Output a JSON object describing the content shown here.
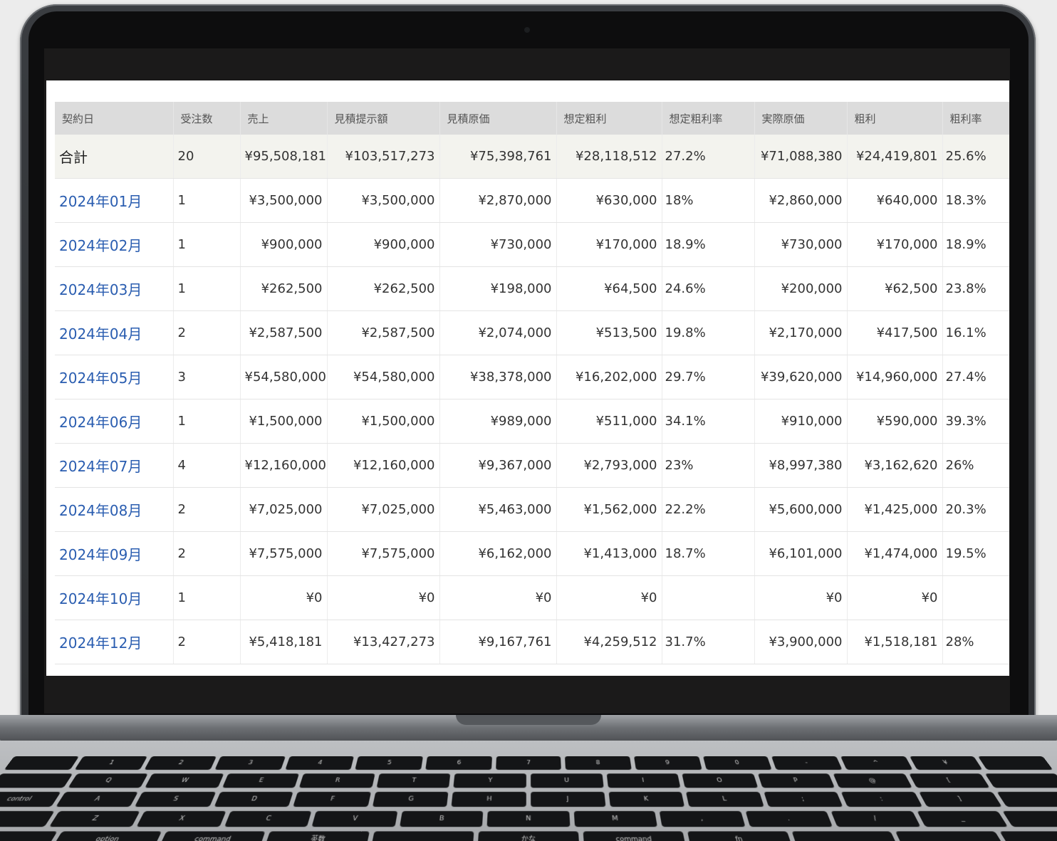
{
  "table": {
    "headers": [
      "契約日",
      "受注数",
      "売上",
      "見積提示額",
      "見積原価",
      "想定粗利",
      "想定粗利率",
      "実際原価",
      "粗利",
      "粗利率"
    ],
    "total": {
      "label": "合計",
      "cells": [
        "20",
        "¥95,508,181",
        "¥103,517,273",
        "¥75,398,761",
        "¥28,118,512",
        "27.2%",
        "¥71,088,380",
        "¥24,419,801",
        "25.6%"
      ]
    },
    "rows": [
      {
        "month": "2024年01月",
        "cells": [
          "1",
          "¥3,500,000",
          "¥3,500,000",
          "¥2,870,000",
          "¥630,000",
          "18%",
          "¥2,860,000",
          "¥640,000",
          "18.3%"
        ]
      },
      {
        "month": "2024年02月",
        "cells": [
          "1",
          "¥900,000",
          "¥900,000",
          "¥730,000",
          "¥170,000",
          "18.9%",
          "¥730,000",
          "¥170,000",
          "18.9%"
        ]
      },
      {
        "month": "2024年03月",
        "cells": [
          "1",
          "¥262,500",
          "¥262,500",
          "¥198,000",
          "¥64,500",
          "24.6%",
          "¥200,000",
          "¥62,500",
          "23.8%"
        ]
      },
      {
        "month": "2024年04月",
        "cells": [
          "2",
          "¥2,587,500",
          "¥2,587,500",
          "¥2,074,000",
          "¥513,500",
          "19.8%",
          "¥2,170,000",
          "¥417,500",
          "16.1%"
        ]
      },
      {
        "month": "2024年05月",
        "cells": [
          "3",
          "¥54,580,000",
          "¥54,580,000",
          "¥38,378,000",
          "¥16,202,000",
          "29.7%",
          "¥39,620,000",
          "¥14,960,000",
          "27.4%"
        ]
      },
      {
        "month": "2024年06月",
        "cells": [
          "1",
          "¥1,500,000",
          "¥1,500,000",
          "¥989,000",
          "¥511,000",
          "34.1%",
          "¥910,000",
          "¥590,000",
          "39.3%"
        ]
      },
      {
        "month": "2024年07月",
        "cells": [
          "4",
          "¥12,160,000",
          "¥12,160,000",
          "¥9,367,000",
          "¥2,793,000",
          "23%",
          "¥8,997,380",
          "¥3,162,620",
          "26%"
        ]
      },
      {
        "month": "2024年08月",
        "cells": [
          "2",
          "¥7,025,000",
          "¥7,025,000",
          "¥5,463,000",
          "¥1,562,000",
          "22.2%",
          "¥5,600,000",
          "¥1,425,000",
          "20.3%"
        ]
      },
      {
        "month": "2024年09月",
        "cells": [
          "2",
          "¥7,575,000",
          "¥7,575,000",
          "¥6,162,000",
          "¥1,413,000",
          "18.7%",
          "¥6,101,000",
          "¥1,474,000",
          "19.5%"
        ]
      },
      {
        "month": "2024年10月",
        "cells": [
          "1",
          "¥0",
          "¥0",
          "¥0",
          "¥0",
          "",
          "¥0",
          "¥0",
          ""
        ]
      },
      {
        "month": "2024年12月",
        "cells": [
          "2",
          "¥5,418,181",
          "¥13,427,273",
          "¥9,167,761",
          "¥4,259,512",
          "31.7%",
          "¥3,900,000",
          "¥1,518,181",
          "28%"
        ]
      }
    ]
  },
  "keyboard": {
    "rows": [
      [
        "",
        "1",
        "2",
        "3",
        "4",
        "5",
        "6",
        "7",
        "8",
        "9",
        "0",
        "-",
        "^",
        "¥",
        ""
      ],
      [
        "",
        "Q",
        "W",
        "E",
        "R",
        "T",
        "Y",
        "U",
        "I",
        "O",
        "P",
        "@",
        "[",
        ""
      ],
      [
        "control",
        "A",
        "S",
        "D",
        "F",
        "G",
        "H",
        "J",
        "K",
        "L",
        ";",
        ":",
        "]",
        ""
      ],
      [
        "",
        "Z",
        "X",
        "C",
        "V",
        "B",
        "N",
        "M",
        ",",
        ".",
        "/",
        "_",
        ""
      ],
      [
        "",
        "option",
        "command",
        "英数",
        "",
        "かな",
        "command",
        "fn",
        "",
        "",
        ""
      ]
    ]
  }
}
